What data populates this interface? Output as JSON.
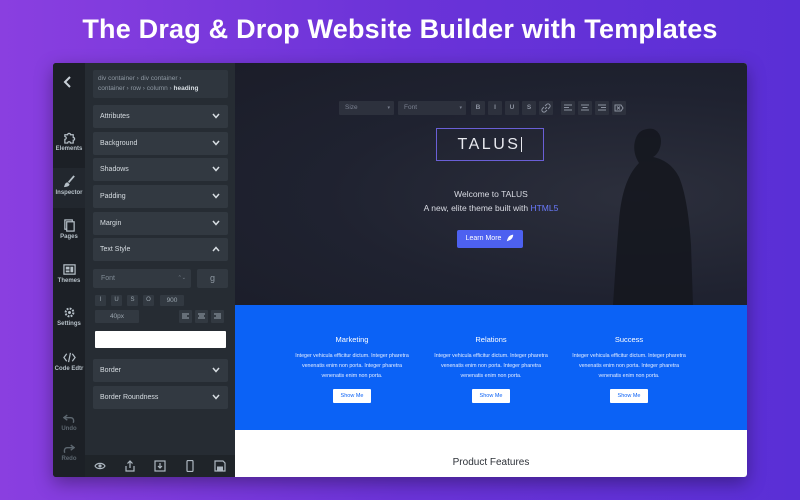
{
  "headline": "The Drag & Drop Website Builder with Templates",
  "rail": {
    "items": [
      {
        "label": "Elements",
        "icon": "puzzle-icon"
      },
      {
        "label": "Inspector",
        "icon": "brush-icon"
      },
      {
        "label": "Pages",
        "icon": "pages-icon"
      },
      {
        "label": "Themes",
        "icon": "themes-icon"
      },
      {
        "label": "Settings",
        "icon": "gear-icon"
      },
      {
        "label": "Code Edtr",
        "icon": "code-icon"
      },
      {
        "label": "Undo",
        "icon": "undo-icon"
      },
      {
        "label": "Redo",
        "icon": "redo-icon"
      }
    ],
    "active": "Inspector"
  },
  "breadcrumb": {
    "line1": "div container  ›  div container  ›",
    "line2": "container  ›  row  ›  column  ›",
    "current": "heading"
  },
  "sections": {
    "attributes": "Attributes",
    "background": "Background",
    "shadows": "Shadows",
    "padding": "Padding",
    "margin": "Margin",
    "text_style": "Text Style",
    "border": "Border",
    "border_roundness": "Border Roundness"
  },
  "text_style": {
    "font_placeholder": "Font",
    "google_glyph": "g",
    "italic": "I",
    "underline": "U",
    "strike": "S",
    "outline": "O",
    "weight": "900",
    "size": "40px",
    "color": "#ffffff"
  },
  "canvas_toolbar": {
    "size": "Size",
    "font": "Font",
    "bold": "B",
    "italic": "I",
    "underline": "U",
    "strike": "S"
  },
  "hero": {
    "brand": "TALUS",
    "line1": "Welcome to TALUS",
    "line2_prefix": "A new, elite theme built with ",
    "line2_highlight": "HTML5",
    "cta": "Learn More"
  },
  "features": [
    {
      "title": "Marketing",
      "text": "Integer vehicula efficitur dictum. Integer pharetra venenatis enim non porta. Integer pharetra venenatis enim non porta.",
      "button": "Show Me"
    },
    {
      "title": "Relations",
      "text": "Integer vehicula efficitur dictum. Integer pharetra venenatis enim non porta. Integer pharetra venenatis enim non porta.",
      "button": "Show Me"
    },
    {
      "title": "Success",
      "text": "Integer vehicula efficitur dictum. Integer pharetra venenatis enim non porta. Integer pharetra venenatis enim non porta.",
      "button": "Show Me"
    }
  ],
  "product_features": "Product Features",
  "colors": {
    "accent": "#4d61f0",
    "features_bg": "#0b62f6",
    "panel_bg": "#262c33"
  }
}
